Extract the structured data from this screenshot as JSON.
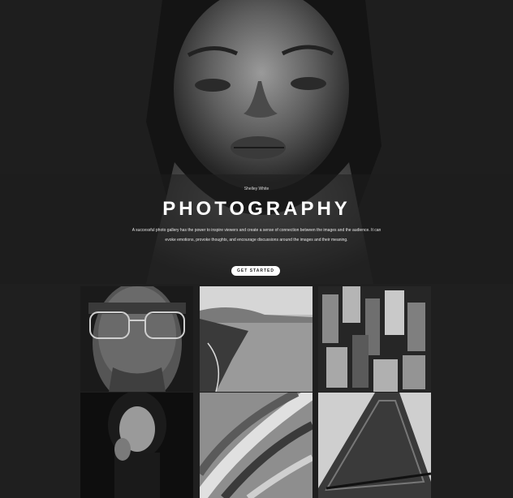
{
  "hero": {
    "author": "Shelley White",
    "title": "PHOTOGRAPHY",
    "description": "A successful photo gallery has the power to inspire viewers and create a sense of connection between the images and the audience. It can evoke emotions, provoke thoughts, and encourage discussions around the images and their meaning.",
    "cta_label": "GET STARTED",
    "image": "portrait-of-woman-photo"
  },
  "gallery": {
    "items": [
      {
        "image": "man-with-glasses-photo"
      },
      {
        "image": "coastal-landscape-photo"
      },
      {
        "image": "city-skyscrapers-photo"
      },
      {
        "image": "woman-portrait-photo"
      },
      {
        "image": "abstract-architecture-photo"
      },
      {
        "image": "eiffel-tower-photo"
      }
    ]
  },
  "colors": {
    "background": "#1f1f1f",
    "button_bg": "#ffffff",
    "button_text": "#222222"
  }
}
